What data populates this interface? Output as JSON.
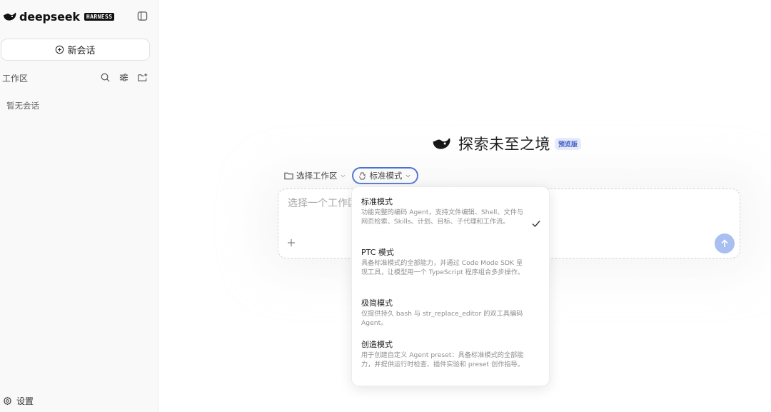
{
  "sidebar": {
    "brand_name": "deepseek",
    "brand_badge": "HARNESS",
    "new_chat_label": "新会话",
    "workspace_label": "工作区",
    "empty_text": "暂无会话",
    "settings_label": "设置",
    "icons": [
      "whale-logo-icon",
      "sidebar-toggle-icon",
      "plus-circle-icon",
      "search-icon",
      "filter-sliders-icon",
      "new-folder-icon",
      "gear-icon"
    ]
  },
  "main": {
    "hero_title": "探索未至之境",
    "hero_badge": "预览版",
    "workspace_select_label": "选择工作区",
    "mode_select_label": "标准模式",
    "composer_placeholder": "选择一个工作区",
    "accent_color": "#2f5fd0",
    "send_button_color": "#a9bff0"
  },
  "mode_menu": {
    "selected_index": 0,
    "options": [
      {
        "title": "标准模式",
        "desc": "功能完整的编码 Agent，支持文件编辑、Shell、文件与网页检索、Skills、计划、目标、子代理和工作流。"
      },
      {
        "title": "PTC 模式",
        "desc": "具备标准模式的全部能力，并通过 Code Mode SDK 呈现工具，让模型用一个 TypeScript 程序组合多步操作。"
      },
      {
        "title": "极简模式",
        "desc": "仅提供持久 bash 与 str_replace_editor 的双工具编码 Agent。"
      },
      {
        "title": "创造模式",
        "desc": "用于创建自定义 Agent preset：具备标准模式的全部能力，并提供运行时检查、插件实验和 preset 创作指导。"
      }
    ]
  }
}
